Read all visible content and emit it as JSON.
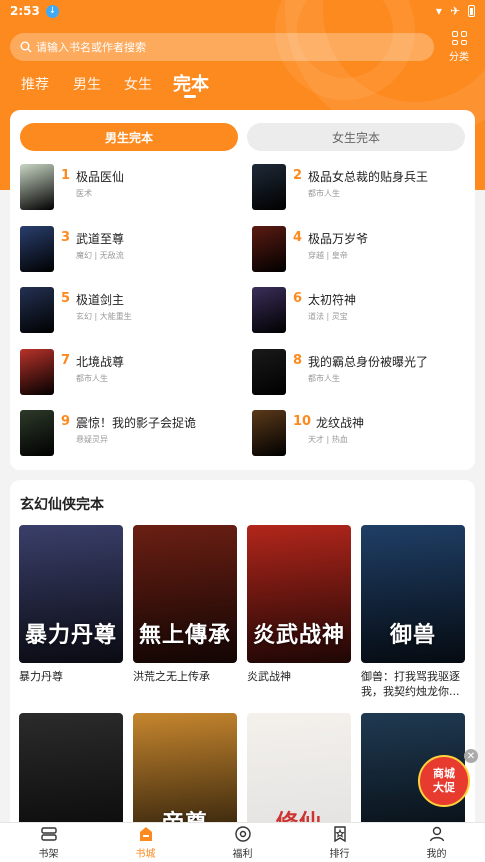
{
  "status": {
    "time": "2:53",
    "download_glyph": "↓",
    "wifi_glyph": "▾",
    "airplane_glyph": "✈"
  },
  "search": {
    "placeholder": "请输入书名或作者搜索",
    "icon": "search-icon"
  },
  "category": {
    "label": "分类",
    "icon": "grid-icon"
  },
  "top_tabs": [
    {
      "label": "推荐",
      "active": false
    },
    {
      "label": "男生",
      "active": false
    },
    {
      "label": "女生",
      "active": false
    },
    {
      "label": "完本",
      "active": true
    }
  ],
  "segments": {
    "male": "男生完本",
    "female": "女生完本"
  },
  "ranking": [
    {
      "num": "1",
      "title": "极品医仙",
      "sub": "医术",
      "color": "#c9d6c4"
    },
    {
      "num": "2",
      "title": "极品女总裁的贴身兵王",
      "sub": "都市人生",
      "color": "#1f2a38"
    },
    {
      "num": "3",
      "title": "武道至尊",
      "sub": "魔幻 | 无敌流",
      "color": "#2a3f6e"
    },
    {
      "num": "4",
      "title": "极品万岁爷",
      "sub": "穿越 | 皇帝",
      "color": "#5b1b12"
    },
    {
      "num": "5",
      "title": "极道剑主",
      "sub": "玄幻 | 大能重生",
      "color": "#233152"
    },
    {
      "num": "6",
      "title": "太初符神",
      "sub": "道法 | 灵宝",
      "color": "#3b2e5a"
    },
    {
      "num": "7",
      "title": "北境战尊",
      "sub": "都市人生",
      "color": "#b8322a"
    },
    {
      "num": "8",
      "title": "我的霸总身份被曝光了",
      "sub": "都市人生",
      "color": "#1a1a1a"
    },
    {
      "num": "9",
      "title": "震惊！我的影子会捉诡",
      "sub": "悬疑灵异",
      "color": "#2d3a2a"
    },
    {
      "num": "10",
      "title": "龙纹战神",
      "sub": "天才 | 热血",
      "color": "#5b3a1a"
    }
  ],
  "section": {
    "title": "玄幻仙侠完本",
    "books": [
      {
        "title": "暴力丹尊",
        "cover_text": "暴力丹尊",
        "color": "#3a3f6a"
      },
      {
        "title": "洪荒之无上传承",
        "cover_text": "無上傳承",
        "color": "#6b1f13"
      },
      {
        "title": "炎武战神",
        "cover_text": "炎武战神",
        "color": "#b2261b"
      },
      {
        "title": "御兽：打我骂我驱逐我，我契约烛龙你...",
        "cover_text": "御兽",
        "color": "#1f3f66"
      },
      {
        "title": "",
        "cover_text": "",
        "color": "#2b2b2b"
      },
      {
        "title": "",
        "cover_text": "帝尊",
        "color": "#c6862e"
      },
      {
        "title": "",
        "cover_text": "修仙",
        "color": "#f4f1ec"
      },
      {
        "title": "",
        "cover_text": "",
        "color": "#1f3a52"
      }
    ]
  },
  "promo": {
    "line1": "商城",
    "line2": "大促",
    "close": "✕"
  },
  "bottom_nav": [
    {
      "label": "书架",
      "icon": "bookshelf-icon",
      "active": false
    },
    {
      "label": "书城",
      "icon": "bookstore-icon",
      "active": true
    },
    {
      "label": "福利",
      "icon": "welfare-icon",
      "active": false
    },
    {
      "label": "排行",
      "icon": "ranking-icon",
      "active": false
    },
    {
      "label": "我的",
      "icon": "profile-icon",
      "active": false
    }
  ],
  "colors": {
    "accent": "#fd8a1f",
    "background": "#f3f3f3"
  }
}
